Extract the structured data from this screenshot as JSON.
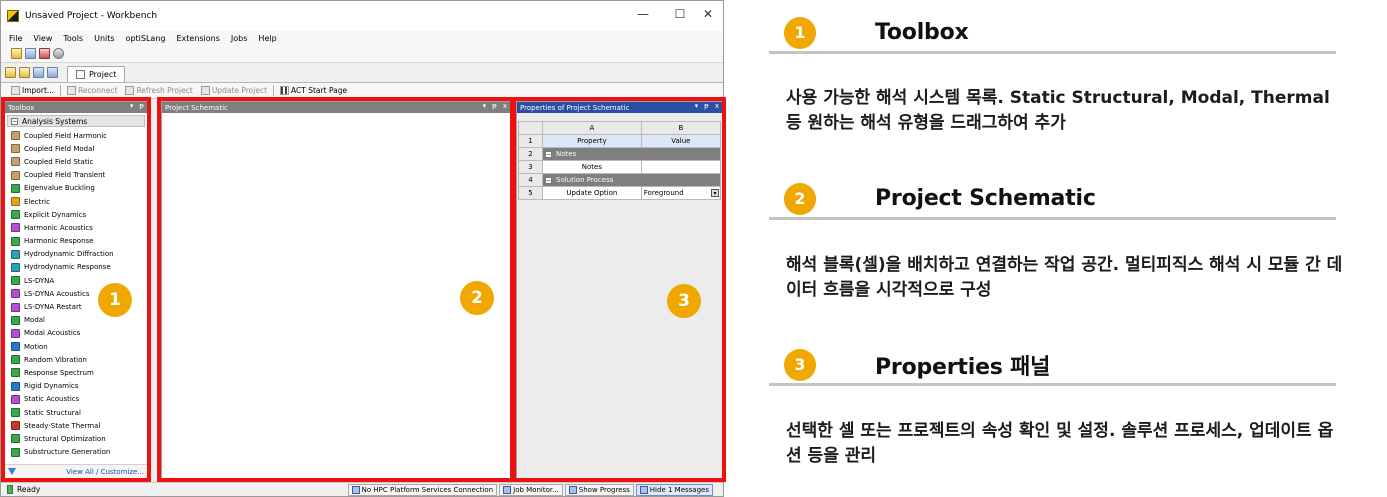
{
  "window": {
    "title": "Unsaved Project - Workbench",
    "controls": {
      "minimize": "—",
      "maximize": "☐",
      "close": "✕"
    }
  },
  "menu": [
    "File",
    "View",
    "Tools",
    "Units",
    "optiSLang",
    "Extensions",
    "Jobs",
    "Help"
  ],
  "project_tab": "Project",
  "action_toolbar": {
    "import": "Import...",
    "reconnect": "Reconnect",
    "refresh": "Refresh Project",
    "update": "Update Project",
    "act_start": "ACT Start Page"
  },
  "toolbox": {
    "header": "Toolbox",
    "group": "Analysis Systems",
    "items": [
      {
        "label": "Coupled Field Harmonic",
        "color": "#c7a06a"
      },
      {
        "label": "Coupled Field Modal",
        "color": "#c7a06a"
      },
      {
        "label": "Coupled Field Static",
        "color": "#c7a06a"
      },
      {
        "label": "Coupled Field Transient",
        "color": "#c7a06a"
      },
      {
        "label": "Eigenvalue Buckling",
        "color": "#3aa84a"
      },
      {
        "label": "Electric",
        "color": "#e6a21e"
      },
      {
        "label": "Explicit Dynamics",
        "color": "#3aa84a"
      },
      {
        "label": "Harmonic Acoustics",
        "color": "#b34fd1"
      },
      {
        "label": "Harmonic Response",
        "color": "#3aa84a"
      },
      {
        "label": "Hydrodynamic Diffraction",
        "color": "#2a9fb6"
      },
      {
        "label": "Hydrodynamic Response",
        "color": "#2a9fb6"
      },
      {
        "label": "LS-DYNA",
        "color": "#3aa84a"
      },
      {
        "label": "LS-DYNA Acoustics",
        "color": "#b34fd1"
      },
      {
        "label": "LS-DYNA Restart",
        "color": "#b34fd1"
      },
      {
        "label": "Modal",
        "color": "#3aa84a"
      },
      {
        "label": "Modal Acoustics",
        "color": "#b34fd1"
      },
      {
        "label": "Motion",
        "color": "#2a79c9"
      },
      {
        "label": "Random Vibration",
        "color": "#3aa84a"
      },
      {
        "label": "Response Spectrum",
        "color": "#3aa84a"
      },
      {
        "label": "Rigid Dynamics",
        "color": "#2a79c9"
      },
      {
        "label": "Static Acoustics",
        "color": "#b34fd1"
      },
      {
        "label": "Static Structural",
        "color": "#3aa84a"
      },
      {
        "label": "Steady-State Thermal",
        "color": "#c23a2a"
      },
      {
        "label": "Structural Optimization",
        "color": "#3aa84a"
      },
      {
        "label": "Substructure Generation",
        "color": "#3aa84a"
      }
    ],
    "footer_link": "View All / Customize..."
  },
  "schematic": {
    "header": "Project Schematic"
  },
  "properties": {
    "header": "Properties of Project Schematic",
    "col_a": "A",
    "col_b": "B",
    "rows": [
      {
        "n": "1",
        "a": "Property",
        "b": "Value"
      },
      {
        "n": "2",
        "section": "Notes"
      },
      {
        "n": "3",
        "a": "Notes",
        "b": ""
      },
      {
        "n": "4",
        "section": "Solution Process"
      },
      {
        "n": "5",
        "a": "Update Option",
        "b": "Foreground"
      }
    ]
  },
  "status": {
    "ready": "Ready",
    "hpc": "No HPC Platform Services Connection",
    "job_monitor": "Job Monitor...",
    "show_progress": "Show Progress",
    "messages": "Hide 1 Messages"
  },
  "badges": [
    "1",
    "2",
    "3"
  ],
  "sections": [
    {
      "num": "1",
      "title": "Toolbox",
      "desc": "사용 가능한 해석 시스템 목록. Static Structural, Modal, Thermal 등 원하는 해석 유형을 드래그하여 추가"
    },
    {
      "num": "2",
      "title": "Project Schematic",
      "desc": "해석 블록(셀)을 배치하고 연결하는 작업 공간. 멀티피직스 해석 시 모듈 간 데이터 흐름을 시각적으로 구성"
    },
    {
      "num": "3",
      "title": "Properties 패널",
      "desc": "선택한 셀 또는 프로젝트의 속성 확인 및 설정. 솔루션 프로세스, 업데이트 옵션 등을 관리"
    }
  ],
  "colors": {
    "highlight": "#ee1111",
    "badge": "#f0a800",
    "panel_header": "#7f7f7f",
    "properties_header": "#2c4ea3"
  }
}
